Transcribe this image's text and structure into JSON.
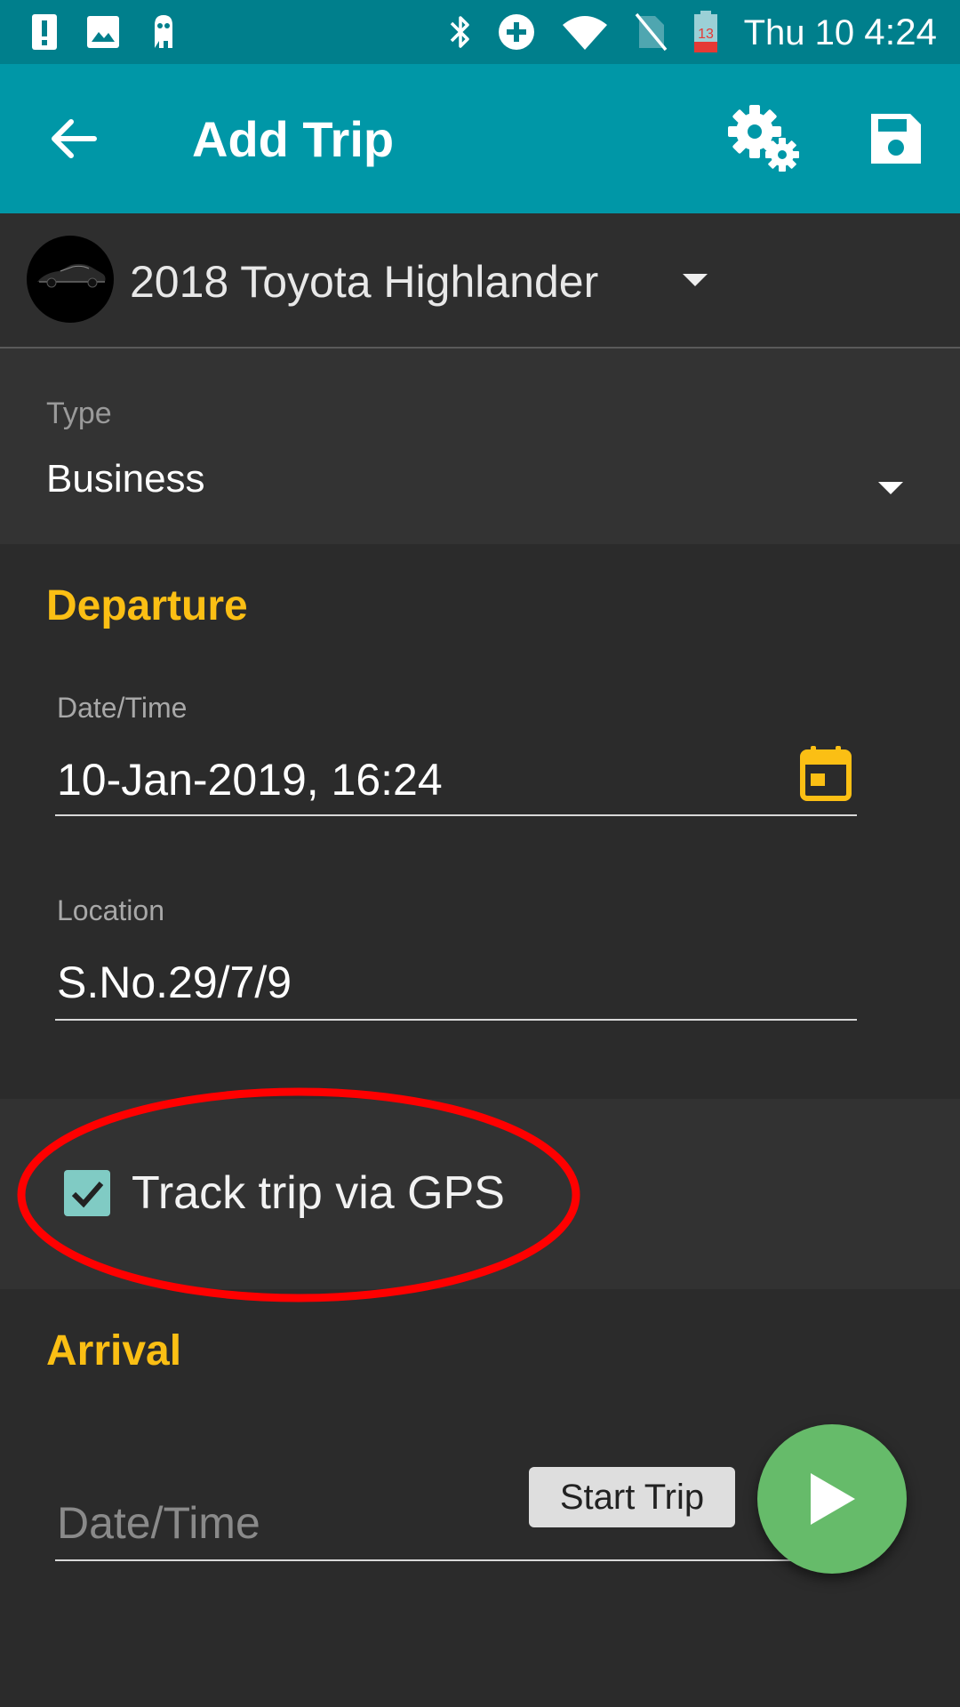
{
  "status_bar": {
    "day_date": "Thu 10",
    "time": "4:24",
    "calendar_badge": "13",
    "icons": [
      "alert-icon",
      "image-icon",
      "app-notification-icon",
      "bluetooth-icon",
      "data-saver-icon",
      "wifi-icon",
      "no-sim-icon",
      "battery-icon"
    ]
  },
  "app_bar": {
    "title": "Add Trip",
    "icons": [
      "back-arrow-icon",
      "settings-gears-icon",
      "save-icon"
    ],
    "color": "#0097a7"
  },
  "vehicle": {
    "name": "2018 Toyota Highlander"
  },
  "trip_type": {
    "label": "Type",
    "value": "Business"
  },
  "departure": {
    "title": "Departure",
    "datetime_label": "Date/Time",
    "datetime_value": "10-Jan-2019, 16:24",
    "location_label": "Location",
    "location_value": "S.No.29/7/9"
  },
  "gps": {
    "label": "Track trip via GPS",
    "checked": true
  },
  "arrival": {
    "title": "Arrival",
    "datetime_placeholder": "Date/Time",
    "start_trip_label": "Start Trip"
  },
  "colors": {
    "accent": "#fbbf14",
    "status_bar": "#007f8c",
    "fab": "#66bb6a",
    "checkbox": "#80cbc4",
    "annotation": "#ff0000"
  }
}
